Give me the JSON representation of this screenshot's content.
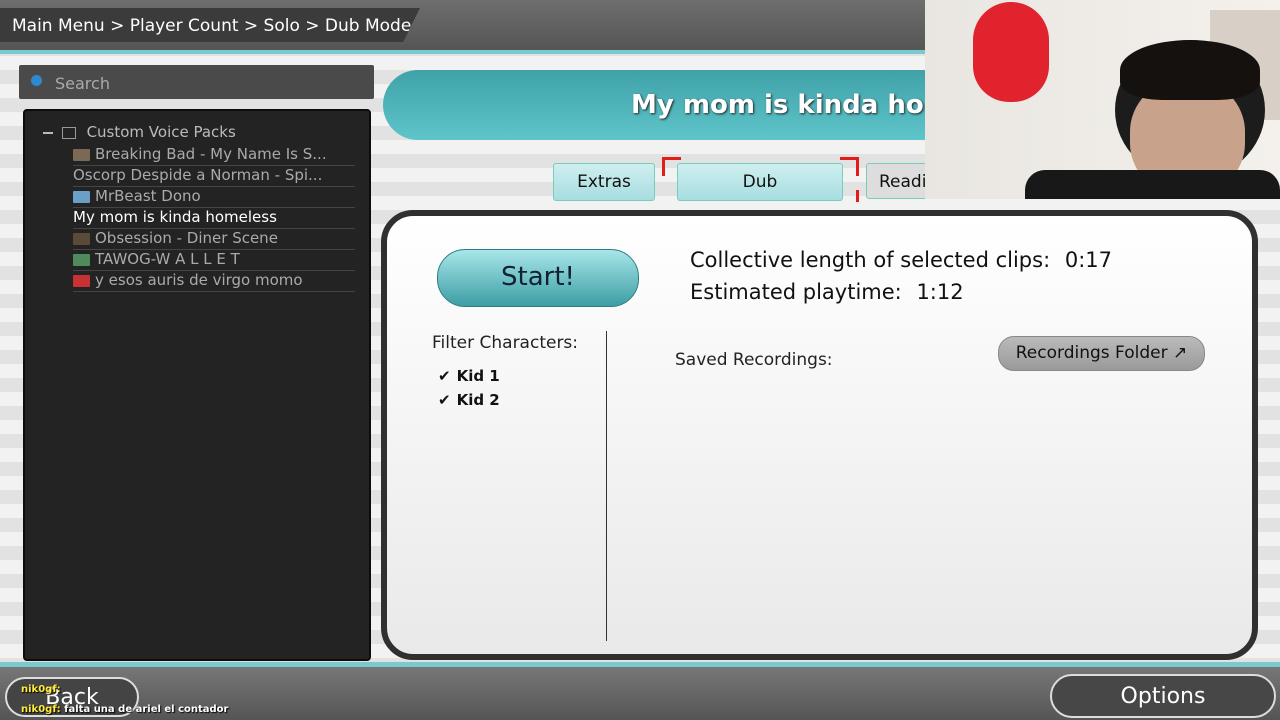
{
  "breadcrumb": "Main Menu > Player Count > Solo > Dub Mode",
  "search": {
    "placeholder": "Search"
  },
  "tree": {
    "root_label": "Custom Voice Packs",
    "items": [
      {
        "label": "Breaking Bad - My Name Is S...",
        "thumb_color": "#7a6a55"
      },
      {
        "label": "Oscorp Despide a Norman - Spi...",
        "thumb_color": ""
      },
      {
        "label": "MrBeast Dono",
        "thumb_color": "#6aa0c8"
      },
      {
        "label": "My mom is kinda homeless",
        "thumb_color": ""
      },
      {
        "label": "Obsession - Diner Scene",
        "thumb_color": "#5b4a3a"
      },
      {
        "label": "TAWOG-W A L L E T",
        "thumb_color": "#4e8a5a"
      },
      {
        "label": "y esos auris de virgo momo",
        "thumb_color": "#c83232"
      }
    ]
  },
  "title": "My mom is kinda hon",
  "tabs": {
    "extras": "Extras",
    "dub": "Dub",
    "read": "Readi"
  },
  "start_label": "Start!",
  "info": {
    "length_label": "Collective length of selected clips:",
    "length_value": "0:17",
    "playtime_label": "Estimated playtime:",
    "playtime_value": "1:12"
  },
  "filter": {
    "title": "Filter Characters:",
    "items": [
      "Kid 1",
      "Kid 2"
    ],
    "check": "✔"
  },
  "saved_label": "Saved Recordings:",
  "recordings_folder": "Recordings Folder ↗",
  "back_label": "Back",
  "options_label": "Options",
  "chat": [
    {
      "user": "nik0gf:",
      "message": ""
    },
    {
      "user": "nik0gf:",
      "message": "falta una de ariel el contador"
    }
  ],
  "colors": {
    "accent": "#5ec5ca",
    "selection_frame": "#e21b1b"
  }
}
